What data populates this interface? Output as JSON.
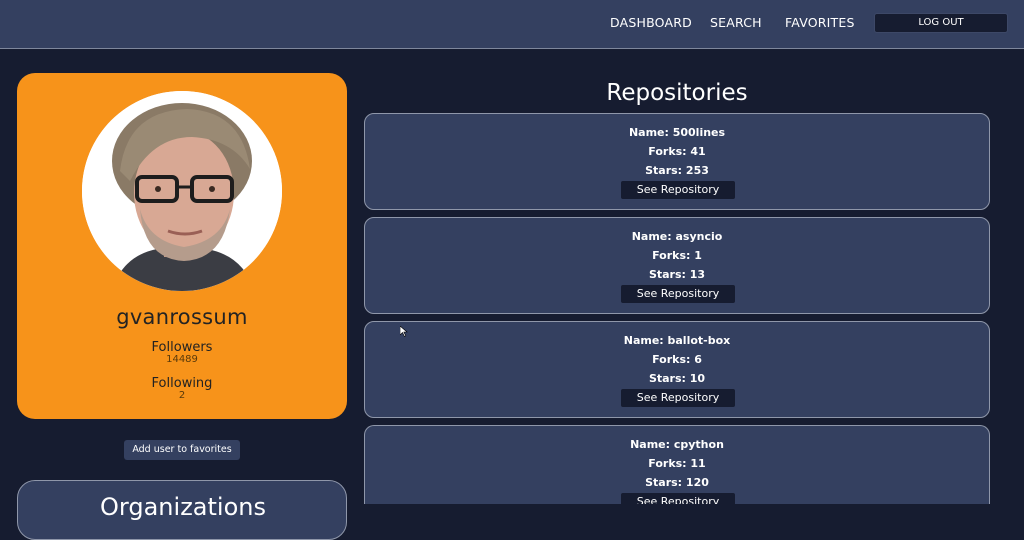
{
  "nav": {
    "dashboard": "DASHBOARD",
    "search": "SEARCH",
    "favorites": "FAVORITES",
    "logout": "LOG OUT"
  },
  "profile": {
    "username": "gvanrossum",
    "followers_label": "Followers",
    "followers_value": "14489",
    "following_label": "Following",
    "following_value": "2",
    "add_favorite": "Add user to favorites"
  },
  "organizations": {
    "title": "Organizations"
  },
  "repositories": {
    "title": "Repositories",
    "button_label": "See Repository",
    "items": [
      {
        "name": "Name: 500lines",
        "forks": "Forks: 41",
        "stars": "Stars: 253"
      },
      {
        "name": "Name: asyncio",
        "forks": "Forks: 1",
        "stars": "Stars: 13"
      },
      {
        "name": "Name: ballot-box",
        "forks": "Forks: 6",
        "stars": "Stars: 10"
      },
      {
        "name": "Name: cpython",
        "forks": "Forks: 11",
        "stars": "Stars: 120"
      }
    ]
  },
  "colors": {
    "background": "#161c30",
    "navbar": "#344060",
    "profile_card": "#f7931a",
    "repo_card": "#344060"
  }
}
